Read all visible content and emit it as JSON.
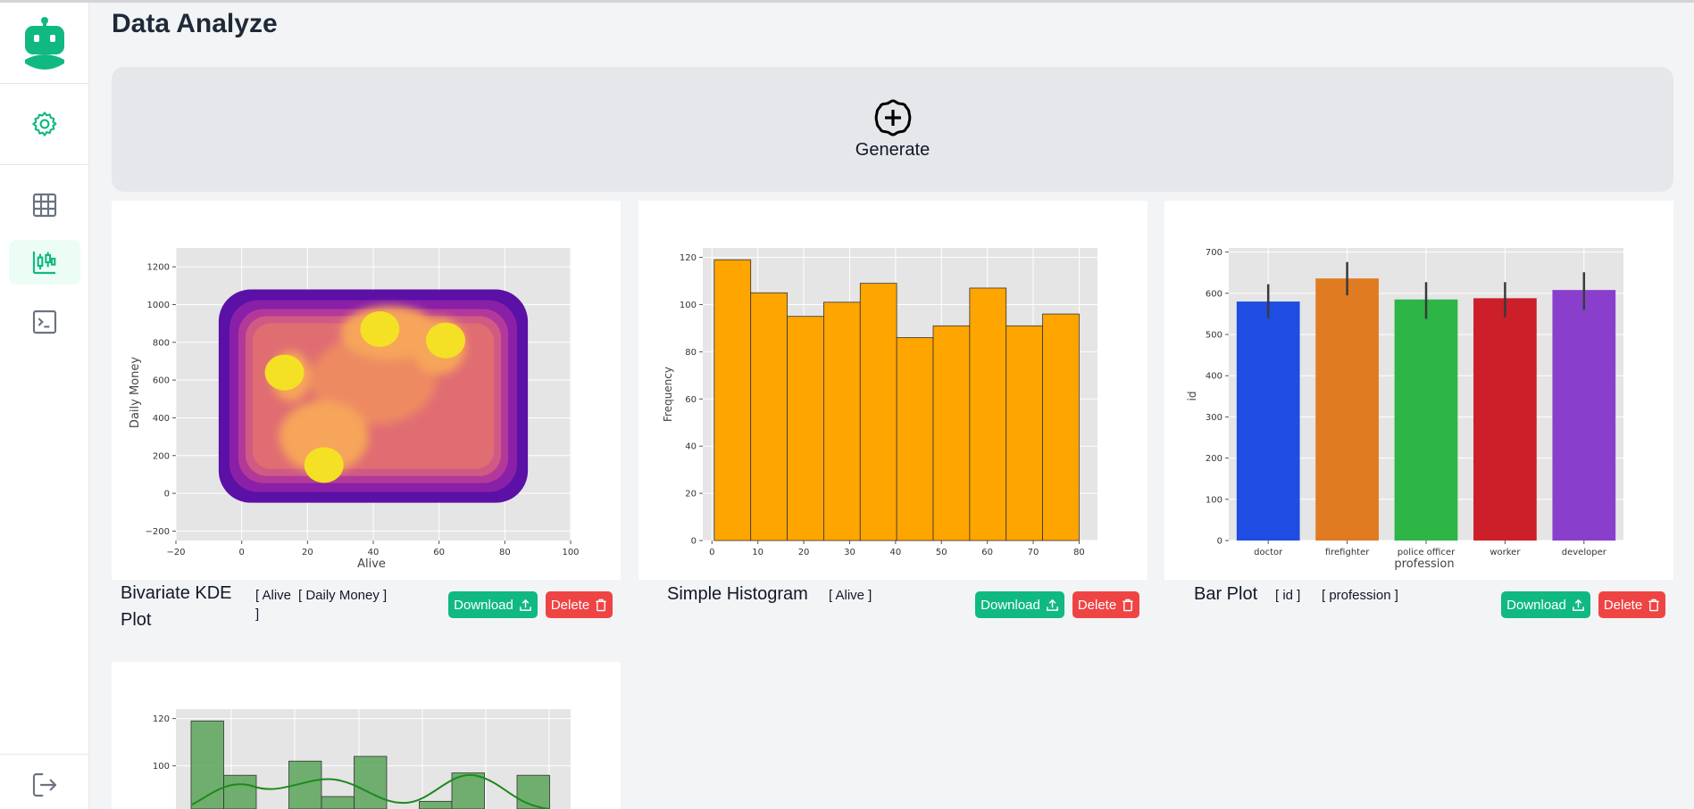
{
  "page": {
    "title": "Data Analyze"
  },
  "sidebar": {
    "logo": "robot-logo-icon",
    "items": [
      {
        "icon": "settings-gear-icon",
        "active": false
      },
      {
        "icon": "table-grid-icon",
        "active": false
      },
      {
        "icon": "candlestick-chart-icon",
        "active": true
      },
      {
        "icon": "terminal-icon",
        "active": false
      },
      {
        "icon": "logout-icon",
        "active": false
      }
    ]
  },
  "generate": {
    "label": "Generate",
    "icon": "plus-circle-icon"
  },
  "colors": {
    "accent": "#10b981",
    "danger": "#ef4444",
    "histogram": "#ffa500",
    "kde_hist": "#5aa55a"
  },
  "cards": [
    {
      "title": "Bivariate KDE Plot",
      "tags": [
        "[ Alive ]",
        "[ Daily Money ]"
      ],
      "download": "Download",
      "delete": "Delete"
    },
    {
      "title": "Simple Histogram",
      "tags": [
        "[ Alive ]"
      ],
      "download": "Download",
      "delete": "Delete"
    },
    {
      "title": "Bar Plot",
      "tags": [
        "[ id ]",
        "[ profession ]"
      ],
      "download": "Download",
      "delete": "Delete"
    }
  ],
  "chart_data": [
    {
      "type": "heatmap",
      "kind": "bivariate KDE",
      "xlabel": "Alive",
      "ylabel": "Daily Money",
      "xlim": [
        -20,
        100
      ],
      "ylim": [
        -250,
        1300
      ],
      "xticks": [
        -20,
        0,
        20,
        40,
        60,
        80,
        100
      ],
      "yticks": [
        -200,
        0,
        200,
        400,
        600,
        800,
        1000,
        1200
      ],
      "grid": true,
      "peaks": [
        {
          "x": 25,
          "y": 150
        },
        {
          "x": 42,
          "y": 870
        },
        {
          "x": 62,
          "y": 810
        },
        {
          "x": 13,
          "y": 640
        }
      ]
    },
    {
      "type": "bar",
      "kind": "histogram",
      "xlabel": "",
      "ylabel": "Frequency",
      "bin_edges": [
        0.5,
        8.45,
        16.4,
        24.35,
        32.3,
        40.25,
        48.2,
        56.15,
        64.1,
        72.05,
        80
      ],
      "values": [
        119,
        105,
        95,
        101,
        109,
        86,
        91,
        107,
        91,
        96
      ],
      "xlim": [
        -2,
        84
      ],
      "ylim": [
        0,
        124
      ],
      "xticks": [
        0,
        10,
        20,
        30,
        40,
        50,
        60,
        70,
        80
      ],
      "yticks": [
        0,
        20,
        40,
        60,
        80,
        100,
        120
      ],
      "grid": true
    },
    {
      "type": "bar",
      "xlabel": "profession",
      "ylabel": "id",
      "categories": [
        "doctor",
        "firefighter",
        "police officer",
        "worker",
        "developer"
      ],
      "values": [
        580,
        636,
        585,
        588,
        608
      ],
      "errors": [
        [
          540,
          622
        ],
        [
          595,
          676
        ],
        [
          538,
          627
        ],
        [
          542,
          627
        ],
        [
          560,
          651
        ]
      ],
      "bar_colors": [
        "#1f4de2",
        "#e07b22",
        "#2db545",
        "#cc1f2a",
        "#8a3fcc"
      ],
      "ylim": [
        0,
        710
      ],
      "yticks": [
        0,
        100,
        200,
        300,
        400,
        500,
        600,
        700
      ],
      "grid": true
    },
    {
      "type": "bar",
      "kind": "histogram with KDE",
      "values": [
        119,
        96,
        0,
        102,
        87,
        104,
        0,
        85,
        97,
        0,
        96
      ],
      "yticks": [
        100,
        120
      ],
      "grid": true
    }
  ]
}
